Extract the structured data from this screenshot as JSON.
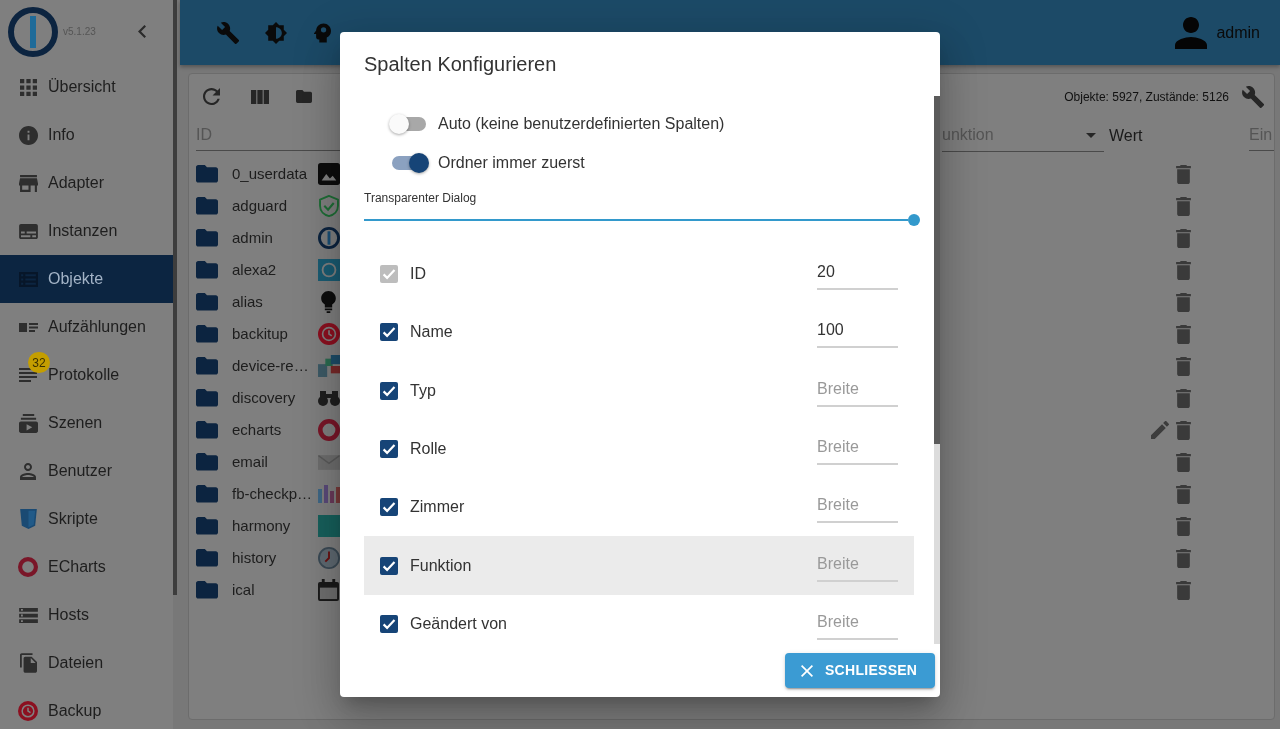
{
  "sidebar": {
    "version": "v5.1.23",
    "items": [
      {
        "label": "Übersicht",
        "selected": false
      },
      {
        "label": "Info",
        "selected": false
      },
      {
        "label": "Adapter",
        "selected": false
      },
      {
        "label": "Instanzen",
        "selected": false
      },
      {
        "label": "Objekte",
        "selected": true
      },
      {
        "label": "Aufzählungen",
        "selected": false
      },
      {
        "label": "Protokolle",
        "selected": false,
        "badge": "32"
      },
      {
        "label": "Szenen",
        "selected": false
      },
      {
        "label": "Benutzer",
        "selected": false
      },
      {
        "label": "Skripte",
        "selected": false
      },
      {
        "label": "ECharts",
        "selected": false
      },
      {
        "label": "Hosts",
        "selected": false
      },
      {
        "label": "Dateien",
        "selected": false
      },
      {
        "label": "Backup",
        "selected": false
      }
    ]
  },
  "top_bar": {
    "user": "admin"
  },
  "objects": {
    "stats": "Objekte: 5927, Zustände: 5126",
    "header": [
      {
        "kind": "input",
        "placeholder": "ID"
      },
      {
        "kind": "select",
        "placeholder": "unktion"
      },
      {
        "kind": "label",
        "text": "Wert"
      },
      {
        "kind": "input",
        "placeholder": "Ein"
      }
    ],
    "rows": [
      {
        "name": "0_userdata",
        "editable": false
      },
      {
        "name": "adguard",
        "editable": false
      },
      {
        "name": "admin",
        "editable": false
      },
      {
        "name": "alexa2",
        "editable": false
      },
      {
        "name": "alias",
        "editable": false
      },
      {
        "name": "backitup",
        "editable": false
      },
      {
        "name": "device-re…",
        "editable": false
      },
      {
        "name": "discovery",
        "editable": false
      },
      {
        "name": "echarts",
        "editable": true
      },
      {
        "name": "email",
        "editable": false
      },
      {
        "name": "fb-checkp…",
        "editable": false
      },
      {
        "name": "harmony",
        "editable": false
      },
      {
        "name": "history",
        "editable": false
      },
      {
        "name": "ical",
        "editable": false
      }
    ]
  },
  "dialog": {
    "title": "Spalten Konfigurieren",
    "switches": [
      {
        "label": "Auto (keine benutzerdefinierten Spalten)",
        "on": false
      },
      {
        "label": "Ordner immer zuerst",
        "on": true
      }
    ],
    "slider": {
      "label": "Transparenter Dialog",
      "level": 1
    },
    "columns": [
      {
        "label": "ID",
        "checked": true,
        "disabled": true,
        "hovered": false,
        "value": "20"
      },
      {
        "label": "Name",
        "checked": true,
        "disabled": false,
        "hovered": false,
        "value": "100"
      },
      {
        "label": "Typ",
        "checked": true,
        "disabled": false,
        "hovered": false,
        "placeholder": "Breite"
      },
      {
        "label": "Rolle",
        "checked": true,
        "disabled": false,
        "hovered": false,
        "placeholder": "Breite"
      },
      {
        "label": "Zimmer",
        "checked": true,
        "disabled": false,
        "hovered": false,
        "placeholder": "Breite"
      },
      {
        "label": "Funktion",
        "checked": true,
        "disabled": false,
        "hovered": true,
        "placeholder": "Breite"
      },
      {
        "label": "Geändert von",
        "checked": true,
        "disabled": false,
        "hovered": false,
        "placeholder": "Breite"
      }
    ],
    "close_button": "SCHLIESSEN"
  }
}
